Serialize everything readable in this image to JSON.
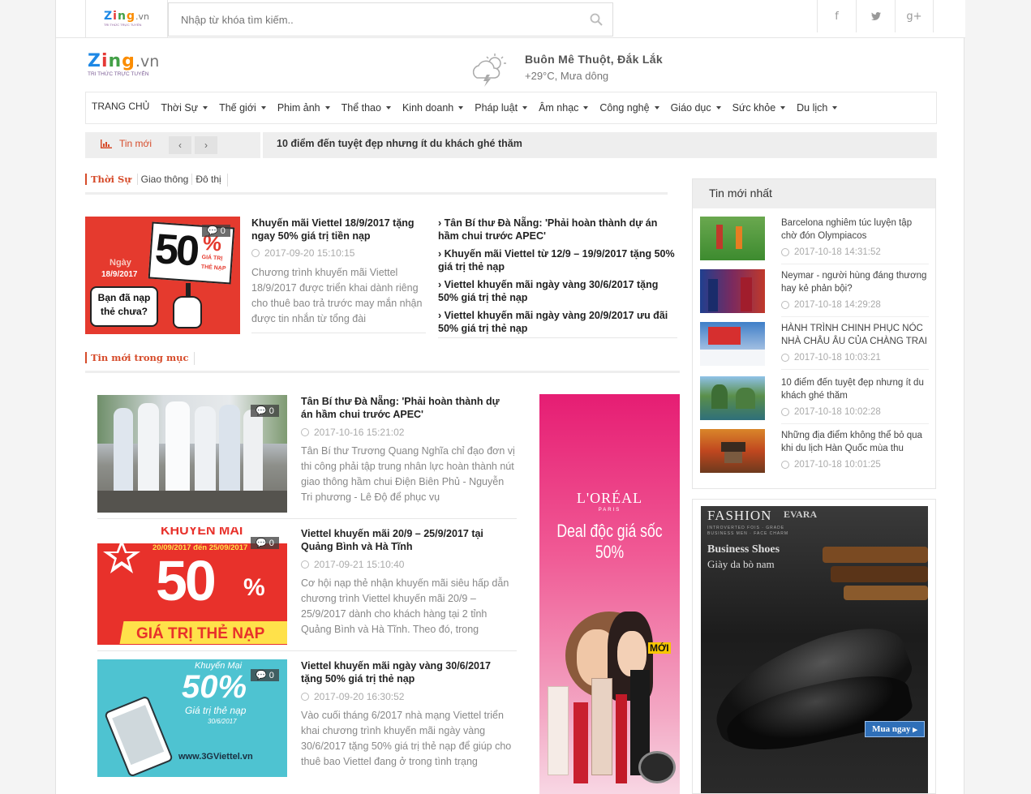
{
  "topbar": {
    "logo": {
      "brand": "Zing",
      "domain": ".vn",
      "tagline": "TRI THỨC TRỰC TUYẾN"
    },
    "search": {
      "placeholder": "Nhập từ khóa tìm kiếm.."
    },
    "social": [
      {
        "icon": "facebook-icon",
        "glyph": "f"
      },
      {
        "icon": "twitter-icon",
        "glyph": "🐦"
      },
      {
        "icon": "google-plus-icon",
        "glyph": "g+"
      }
    ]
  },
  "header": {
    "logo": {
      "brand": "Zing",
      "domain": ".vn",
      "tagline": "TRI THỨC TRỰC TUYẾN"
    },
    "weather": {
      "city": "Buôn Mê Thuột, Đắk Lắk",
      "condition": "+29°C, Mưa dông",
      "icon": "thunderstorm-icon"
    }
  },
  "nav": {
    "home": "TRANG CHỦ",
    "items": [
      "Thời Sự",
      "Thế giới",
      "Phim ảnh",
      "Thể thao",
      "Kinh doanh",
      "Pháp luật",
      "Âm nhạc",
      "Công nghệ",
      "Giáo dục",
      "Sức khỏe",
      "Du lịch"
    ]
  },
  "ticker": {
    "label": "Tin mới",
    "prev": "‹",
    "next": "›",
    "headline": "10 điểm đến tuyệt đẹp nhưng ít du khách ghé thăm"
  },
  "section1": {
    "tabs": [
      "Thời Sự",
      "Giao thông",
      "Đô thị"
    ],
    "featured": {
      "title": "Khuyến mãi Viettel 18/9/2017 tặng ngay 50% giá trị tiền nạp",
      "date": "2017-09-20 15:10:15",
      "desc": "Chương trình khuyến mãi Viettel 18/9/2017 được triển khai dành riêng cho thuê bao trả trước may mắn nhận được tin nhắn từ tổng đài",
      "comments": "0",
      "image": {
        "big": "50",
        "pct": "%",
        "small1": "GIÁ TRỊ",
        "small2": "THẺ NẠP",
        "day": "Ngày",
        "date": "18/9/2017",
        "bubble": "Bạn đã nạp thẻ chưa?"
      }
    },
    "related": [
      "› Tân Bí thư Đà Nẵng: 'Phải hoàn thành dự án hầm chui trước APEC'",
      "› Khuyến mãi Viettel từ 12/9 – 19/9/2017 tặng 50% giá trị thẻ nạp",
      "› Viettel khuyến mãi ngày vàng 30/6/2017 tặng 50% giá trị thẻ nạp",
      "› Viettel khuyến mãi ngày vàng 20/9/2017 ưu đãi 50% giá trị thẻ nạp"
    ]
  },
  "section2": {
    "tab": "Tin mới trong mục",
    "articles": [
      {
        "title": "Tân Bí thư Đà Nẵng: 'Phải hoàn thành dự án hầm chui trước APEC'",
        "date": "2017-10-16 15:21:02",
        "desc": "Tân Bí thư Trương Quang Nghĩa chỉ đạo đơn vị thi công phải tập trung nhân lực hoàn thành nút giao thông hầm chui Điện Biên Phủ - Nguyễn Tri phương - Lê Độ để phục vụ",
        "comments": "0"
      },
      {
        "title": "Viettel khuyến mãi 20/9 – 25/9/2017 tại Quảng Bình và Hà Tĩnh",
        "date": "2017-09-21 15:10:40",
        "desc": "Cơ hội nạp thẻ nhận khuyến mãi siêu hấp dẫn chương trình Viettel khuyến mãi 20/9 – 25/9/2017 dành cho khách hàng tại 2 tỉnh Quảng Bình và Hà Tĩnh. Theo đó, trong",
        "comments": "0",
        "image": {
          "top": "KHUYẾN MÃI",
          "range": "20/09/2017 đến 25/09/2017",
          "big": "50",
          "pct": "%",
          "bottom": "GIÁ TRỊ THẺ NẠP"
        }
      },
      {
        "title": "Viettel khuyến mãi ngày vàng 30/6/2017 tặng 50% giá trị thẻ nạp",
        "date": "2017-09-20 16:30:52",
        "desc": "Vào cuối tháng 6/2017 nhà mạng Viettel triển khai chương trình khuyến mãi ngày vàng 30/6/2017 tặng 50% giá trị thẻ nạp để giúp cho thuê bao Viettel đang ở trong tình trạng",
        "comments": "0",
        "image": {
          "top": "Khuyến Mại",
          "big": "50%",
          "sub": "Giá trị thẻ nạp",
          "date": "30/6/2017",
          "site": "www.3GViettel.vn"
        }
      }
    ]
  },
  "ad_loreal": {
    "brand": "L'ORÉAL",
    "sub": "PARIS",
    "slogan": "Deal độc giá sốc 50%",
    "badge": "MỚI"
  },
  "sidebar": {
    "title": "Tin mới nhất",
    "items": [
      {
        "title": "Barcelona nghiêm túc luyện tập chờ đón Olympiacos",
        "date": "2017-10-18 14:31:52"
      },
      {
        "title": "Neymar - người hùng đáng thương hay kẻ phản bội?",
        "date": "2017-10-18 14:29:28"
      },
      {
        "title": "HÀNH TRÌNH CHINH PHỤC NÓC NHÀ CHÂU ÂU CỦA CHÀNG TRAI",
        "date": "2017-10-18 10:03:21"
      },
      {
        "title": "10 điểm đến tuyệt đẹp nhưng ít du khách ghé thăm",
        "date": "2017-10-18 10:02:28"
      },
      {
        "title": "Những địa điểm không thể bỏ qua khi du lịch Hàn Quốc mùa thu",
        "date": "2017-10-18 10:01:25"
      }
    ]
  },
  "ad_shoes": {
    "brand": "FASHION",
    "brand2": "EVARA",
    "tagline": "INTROVERTED FOIS · GRADE BUSINESS MEN · FACE CHARM",
    "title": "Business Shoes",
    "sub": "Giày da bò nam",
    "cta": "Mua ngay"
  },
  "colors": {
    "accent": "#d64b2a",
    "zing_z": "#1e88e5",
    "zing_i": "#e53935",
    "zing_n": "#43a047",
    "zing_g": "#fb8c00"
  }
}
